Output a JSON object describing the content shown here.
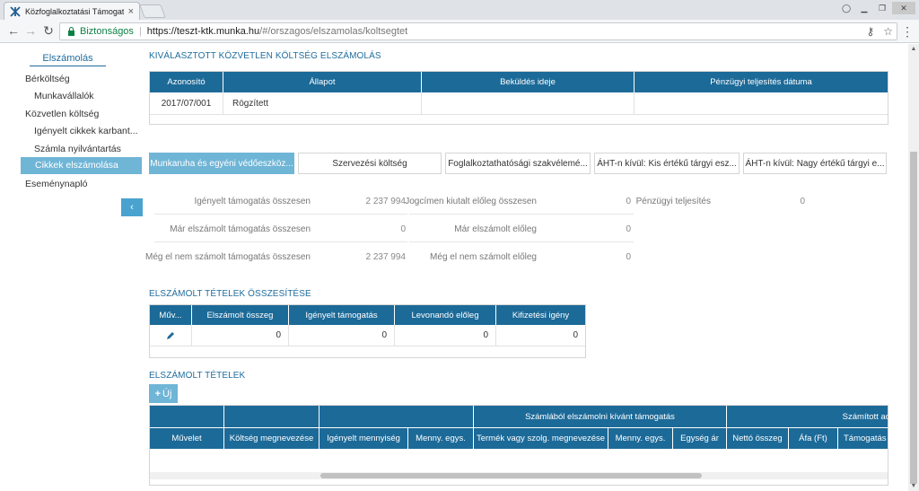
{
  "browser": {
    "tab_title": "Közfoglalkoztatási Támogat",
    "secure_label": "Biztonságos",
    "url_host": "https://teszt-ktk.munka.hu",
    "url_path": "/#/orszagos/elszamolas/koltsegtet"
  },
  "sidebar": {
    "header": "Elszámolás",
    "items": [
      {
        "label": "Bérköltség"
      },
      {
        "label": "Munkavállalók"
      },
      {
        "label": "Közvetlen költség"
      },
      {
        "label": "Igényelt cikkek karbant..."
      },
      {
        "label": "Számla nyilvántartás"
      },
      {
        "label": "Cikkek elszámolása"
      },
      {
        "label": "Eseménynapló"
      }
    ],
    "collapse_icon": "chevron-left-icon"
  },
  "summary": {
    "title": "KIVÁLASZTOTT KÖZVETLEN KÖLTSÉG ELSZÁMOLÁS",
    "columns": [
      "Azonosító",
      "Állapot",
      "Beküldés ideje",
      "Pénzügyi teljesítés dátuma"
    ],
    "row": [
      "2017/07/001",
      "Rögzített",
      "",
      ""
    ]
  },
  "tabs": [
    {
      "label": "Munkaruha és egyéni védőeszköz..."
    },
    {
      "label": "Szervezési költség"
    },
    {
      "label": "Foglalkoztathatósági szakvélemé..."
    },
    {
      "label": "ÁHT-n kívül: Kis értékű tárgyi esz..."
    },
    {
      "label": "ÁHT-n kívül: Nagy értékű tárgyi e..."
    }
  ],
  "stats": {
    "col1": [
      {
        "label": "Igényelt támogatás összesen",
        "value": "2 237 994"
      },
      {
        "label": "Már elszámolt támogatás összesen",
        "value": "0"
      },
      {
        "label": "Még el nem számolt támogatás összesen",
        "value": "2 237 994"
      }
    ],
    "col2": [
      {
        "label": "Jogcímen kiutalt előleg összesen",
        "value": "0"
      },
      {
        "label": "Már elszámolt előleg",
        "value": "0"
      },
      {
        "label": "Még el nem számolt előleg",
        "value": "0"
      }
    ],
    "col3": [
      {
        "label": "Pénzügyi teljesítés",
        "value": "0"
      }
    ]
  },
  "aggregate": {
    "title": "ELSZÁMOLT TÉTELEK ÖSSZESÍTÉSE",
    "columns": [
      "Műv...",
      "Elszámolt összeg",
      "Igényelt támogatás",
      "Levonandó előleg",
      "Kifizetési igény"
    ],
    "row": [
      "",
      "0",
      "0",
      "0",
      "0"
    ],
    "edit_icon": "pencil-icon"
  },
  "items": {
    "title": "ELSZÁMOLT TÉTELEK",
    "add_label": "Új",
    "group_header": "Számlából elszámolni kívánt támogatás",
    "group_header2": "Számított ad",
    "columns": [
      "Művelet",
      "Költség megnevezése",
      "Igényelt mennyiség",
      "Menny. egys.",
      "Termék vagy szolg. megnevezése",
      "Menny. egys.",
      "Egység ár",
      "Nettó összeg",
      "Áfa (Ft)",
      "Támogatás"
    ]
  }
}
